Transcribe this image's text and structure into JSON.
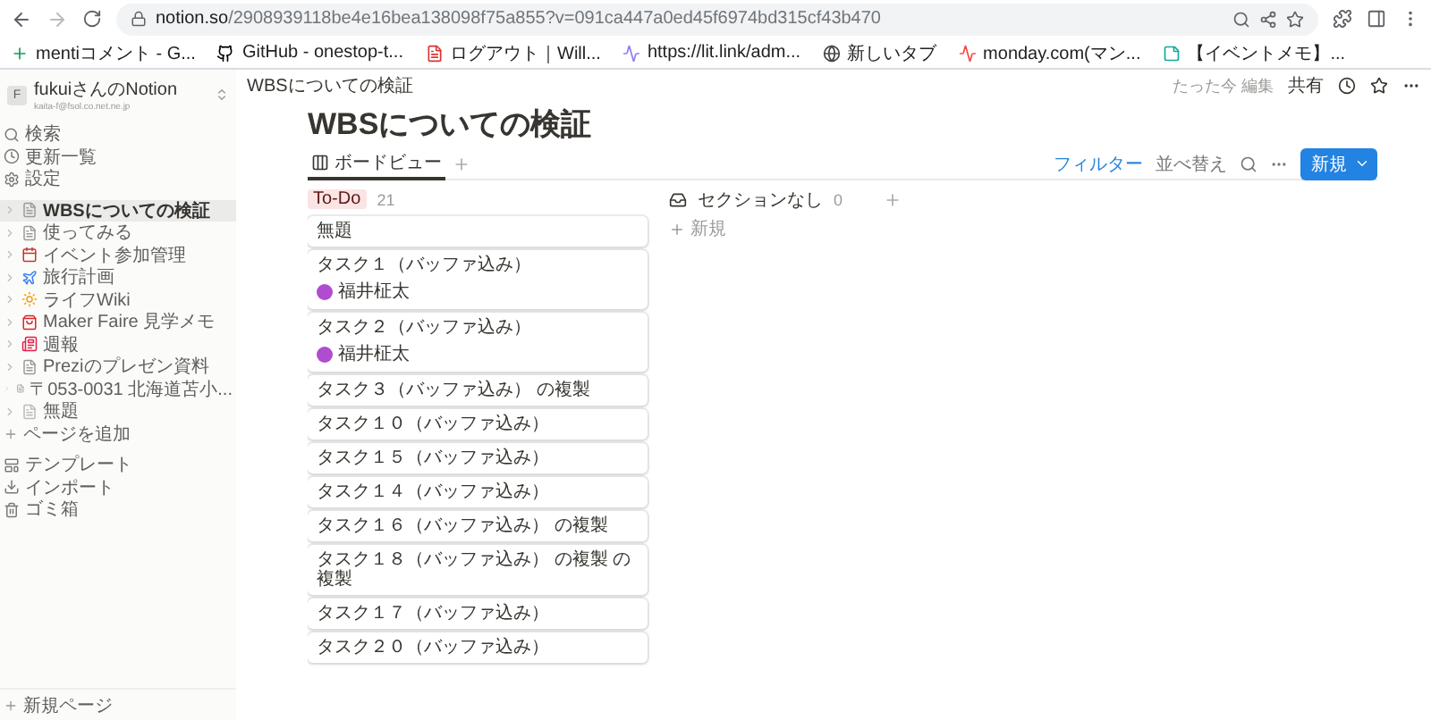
{
  "browser": {
    "url_host": "notion.so",
    "url_path": "/2908939118be4e16bea138098f75a855?v=091ca447a0ed45f6974bd315cf43b470",
    "bookmarks": [
      {
        "label": "mentiコメント - G...",
        "kind": "plus"
      },
      {
        "label": "GitHub - onestop-t...",
        "kind": "github"
      },
      {
        "label": "ログアウト｜Will...",
        "kind": "doc"
      },
      {
        "label": "https://lit.link/adm...",
        "kind": "wave"
      },
      {
        "label": "新しいタブ",
        "kind": "globe"
      },
      {
        "label": "monday.com(マン...",
        "kind": "monday"
      },
      {
        "label": "【イベントメモ】...",
        "kind": "note"
      }
    ]
  },
  "sidebar": {
    "workspace": {
      "initial": "F",
      "name": "fukuiさんのNotion",
      "email": "kaita-f@fsol.co.net.ne.jp"
    },
    "nav": [
      {
        "label": "検索",
        "kind": "search"
      },
      {
        "label": "更新一覧",
        "kind": "clock"
      },
      {
        "label": "設定",
        "kind": "gear"
      }
    ],
    "pages": [
      {
        "label": "WBSについての検証",
        "kind": "doc",
        "selected": true
      },
      {
        "label": "使ってみる",
        "kind": "doc",
        "selected": false
      },
      {
        "label": "イベント参加管理",
        "kind": "event",
        "selected": false
      },
      {
        "label": "旅行計画",
        "kind": "travel",
        "selected": false
      },
      {
        "label": "ライフWiki",
        "kind": "life",
        "selected": false
      },
      {
        "label": "Maker Faire 見学メモ",
        "kind": "bag",
        "selected": false
      },
      {
        "label": "週報",
        "kind": "news",
        "selected": false
      },
      {
        "label": "Preziのプレゼン資料",
        "kind": "doc",
        "selected": false
      },
      {
        "label": "〒053-0031 北海道苫小...",
        "kind": "doc",
        "selected": false
      },
      {
        "label": "無題",
        "kind": "blank",
        "selected": false
      }
    ],
    "add_page": "ページを追加",
    "tools": [
      {
        "label": "テンプレート",
        "kind": "template"
      },
      {
        "label": "インポート",
        "kind": "import"
      },
      {
        "label": "ゴミ箱",
        "kind": "trash"
      }
    ],
    "new_page": "新規ページ"
  },
  "topbar": {
    "breadcrumb": "WBSについての検証",
    "edited": "たった今 編集",
    "share": "共有"
  },
  "title": "WBSについての検証",
  "views": [
    {
      "label": "ボードビュー",
      "selected": true
    }
  ],
  "actions": {
    "filter": "フィルター",
    "sort": "並べ替え",
    "new": "新規"
  },
  "groups": [
    {
      "label": "To-Do",
      "count": "21",
      "kind": "tag",
      "cards": [
        {
          "title": "無題"
        },
        {
          "title": "タスク１（バッファ込み）",
          "assignee": "福井柾太"
        },
        {
          "title": "タスク２（バッファ込み）",
          "assignee": "福井柾太"
        },
        {
          "title": "タスク３（バッファ込み） の複製"
        },
        {
          "title": "タスク１０（バッファ込み）"
        },
        {
          "title": "タスク１５（バッファ込み）"
        },
        {
          "title": "タスク１４（バッファ込み）"
        },
        {
          "title": "タスク１６（バッファ込み） の複製"
        },
        {
          "title": "タスク１８（バッファ込み） の複製 の複製"
        },
        {
          "title": "タスク１７（バッファ込み）"
        },
        {
          "title": "タスク２０（バッファ込み）"
        }
      ]
    },
    {
      "label": "セクションなし",
      "count": "0",
      "kind": "inbox",
      "add_label": "新規"
    }
  ]
}
